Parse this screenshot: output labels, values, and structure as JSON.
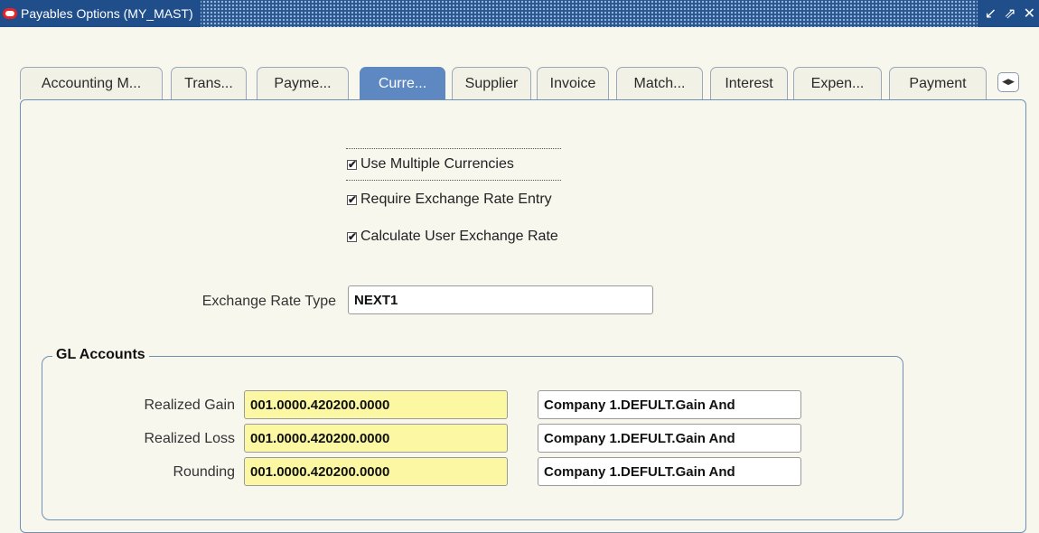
{
  "window": {
    "title": "Payables Options (MY_MAST)",
    "controls": [
      "↙",
      "⇗",
      "✕"
    ]
  },
  "tabs": [
    {
      "label": "Accounting M..."
    },
    {
      "label": "Trans..."
    },
    {
      "label": "Payme..."
    },
    {
      "label": "Curre...",
      "active": true
    },
    {
      "label": "Supplier"
    },
    {
      "label": "Invoice"
    },
    {
      "label": "Match..."
    },
    {
      "label": "Interest"
    },
    {
      "label": "Expen..."
    },
    {
      "label": "Payment"
    }
  ],
  "currency": {
    "use_multiple_currencies": {
      "label": "Use Multiple Currencies",
      "checked": true
    },
    "require_exchange_rate_entry": {
      "label": "Require Exchange Rate Entry",
      "checked": true
    },
    "calculate_user_exchange_rate": {
      "label": "Calculate User Exchange Rate",
      "checked": true
    },
    "exchange_rate_type_label": "Exchange Rate Type",
    "exchange_rate_type_value": "NEXT1"
  },
  "gl_accounts": {
    "title": "GL Accounts",
    "rows": [
      {
        "label": "Realized Gain",
        "account": "001.0000.420200.0000",
        "description": "Company 1.DEFULT.Gain And"
      },
      {
        "label": "Realized Loss",
        "account": "001.0000.420200.0000",
        "description": "Company 1.DEFULT.Gain And"
      },
      {
        "label": "Rounding",
        "account": "001.0000.420200.0000",
        "description": "Company 1.DEFULT.Gain And"
      }
    ]
  },
  "colors": {
    "titlebar": "#1f4e8a",
    "active_tab": "#5e88c2",
    "required_field": "#fbf7a2",
    "background": "#f7f7ee"
  }
}
